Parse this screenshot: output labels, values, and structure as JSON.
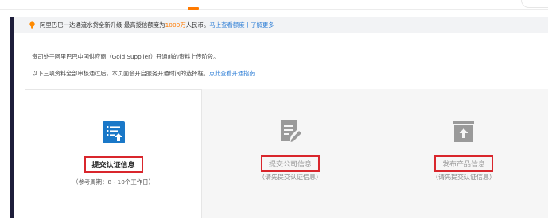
{
  "colors": {
    "accent_orange": "#ff7a00",
    "link_blue": "#2f7fd6",
    "highlight_red": "#d9262c",
    "active_icon_blue": "#1a78c8",
    "inactive_icon_gray": "#9a9a9a",
    "left_rail": "#1d1d3a"
  },
  "notice": {
    "icon": "lightbulb-icon",
    "text_before": "阿里巴巴一达通流水贷全新升级 最高授信额度为",
    "highlight": "1000万",
    "text_after": "人民币。",
    "link": "马上查看额度丨了解更多"
  },
  "intro": {
    "line1": "贵司处于阿里巴巴中国供应商（Gold Supplier）开通前的资料上传阶段。",
    "line2_text": "以下三项资料全部审核通过后，本页面会开启服务开通时间的选择框。",
    "line2_link": "点此查看开通指南"
  },
  "steps": [
    {
      "icon": "submit-certification-icon",
      "title": "提交认证信息",
      "subtitle": "（参考周期：8 - 10个工作日）",
      "active": true
    },
    {
      "icon": "edit-document-icon",
      "title": "提交公司信息",
      "subtitle": "（请先提交认证信息）",
      "active": false
    },
    {
      "icon": "upload-box-icon",
      "title": "发布产品信息",
      "subtitle": "（请先提交认证信息）",
      "active": false
    }
  ]
}
